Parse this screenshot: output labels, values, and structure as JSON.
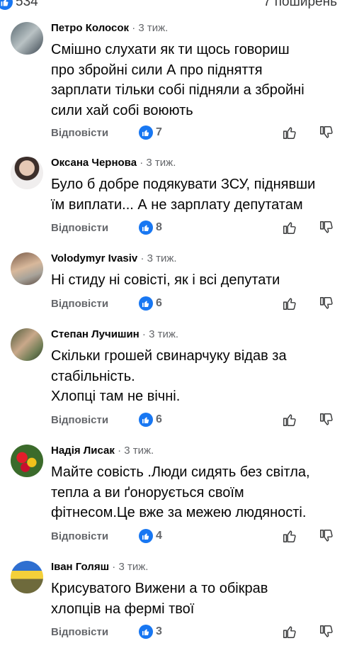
{
  "top": {
    "like_count": "534",
    "shares": "7 поширень"
  },
  "colors": {
    "accent": "#1877f2",
    "meta": "#65676b",
    "text": "#050505"
  },
  "reply_label": "Відповісти",
  "comments": [
    {
      "author": "Петро Колосок",
      "time": "3 тиж.",
      "lines": [
        "Смішно слухати як ти щось говориш",
        "про збройні сили А про підняття",
        "зарплати тільки собі підняли а збройні",
        "сили хай собі воюють"
      ],
      "likes": "7",
      "avatar_icon": "avatar-photo"
    },
    {
      "author": "Оксана Чернова",
      "time": "3 тиж.",
      "lines": [
        "Було б добре подякувати ЗСУ, піднявши",
        "їм виплати... А не зарплату депутатам"
      ],
      "likes": "8",
      "avatar_icon": "avatar-photo"
    },
    {
      "author": "Volodymyr Ivasiv",
      "time": "3 тиж.",
      "lines": [
        "Ні стиду ні совісті, як і всі депутати"
      ],
      "likes": "6",
      "avatar_icon": "avatar-photo"
    },
    {
      "author": "Степан Лучишин",
      "time": "3 тиж.",
      "lines": [
        "Скільки грошей свинарчуку відав за",
        "стабільність.",
        "Хлопці там не вічні."
      ],
      "likes": "6",
      "avatar_icon": "avatar-photo"
    },
    {
      "author": "Надія Лисак",
      "time": "3 тиж.",
      "lines": [
        "Майте совість .Люди сидять без світла,",
        "тепла а ви ґонорується своїм",
        "фітнесом.Це вже за межею людяності."
      ],
      "likes": "4",
      "avatar_icon": "avatar-photo"
    },
    {
      "author": "Іван Голяш",
      "time": "3 тиж.",
      "lines": [
        "Крисуватого  Вижени а то  обікрав",
        "хлопців на фермі твої"
      ],
      "likes": "3",
      "avatar_icon": "avatar-photo"
    }
  ]
}
